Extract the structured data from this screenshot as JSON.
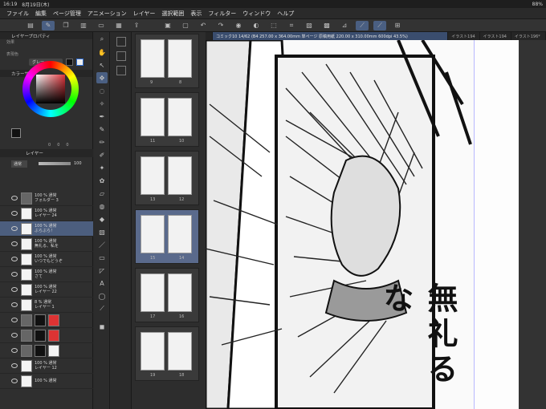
{
  "status": {
    "time": "16:19",
    "date": "8月19日(木)",
    "battery": "88%"
  },
  "menu": [
    "ファイル",
    "編集",
    "ページ管理",
    "アニメーション",
    "レイヤー",
    "選択範囲",
    "表示",
    "フィルター",
    "ウィンドウ",
    "ヘルプ"
  ],
  "tabs": [
    {
      "label": "コミック10"
    },
    {
      "label": "コミック10 14/62 (B4 257.00 x 364.00mm 単ページ 原稿用紙 220.00 x 310.00mm 600dpi 43.5%)"
    },
    {
      "label": "イラスト194"
    },
    {
      "label": "イラスト194"
    },
    {
      "label": "イラスト196*"
    }
  ],
  "left_panel": {
    "layer_property_title": "レイヤープロパティ",
    "effect_label": "効果",
    "preset_label": "表現色",
    "preset_value": "グレー",
    "color_circle_title": "カラーサークル",
    "color_values": [
      "0",
      "0",
      "0"
    ],
    "layer_title": "レイヤー",
    "blend_mode": "通常",
    "opacity": "100"
  },
  "layers": [
    {
      "line1": "100 % 通常",
      "line2": "フォルダー 3",
      "folder": true,
      "selected": false
    },
    {
      "line1": "100 % 通常",
      "line2": "レイヤー 24",
      "folder": false,
      "selected": false
    },
    {
      "line1": "100 % 通常",
      "line2": "ぶらぶら！",
      "folder": false,
      "selected": true
    },
    {
      "line1": "100 % 通常",
      "line2": "無礼る、私を",
      "folder": false,
      "selected": false
    },
    {
      "line1": "100 % 通常",
      "line2": "いつでもどうぞ",
      "folder": false,
      "selected": false
    },
    {
      "line1": "100 % 通常",
      "line2": "さて",
      "folder": false,
      "selected": false
    },
    {
      "line1": "100 % 通常",
      "line2": "レイヤー 22",
      "folder": false,
      "selected": false
    },
    {
      "line1": "8 % 通常",
      "line2": "レイヤー 1",
      "folder": false,
      "selected": false
    },
    {
      "line1": "",
      "line2": "",
      "folder": true,
      "selected": false
    },
    {
      "line1": "",
      "line2": "",
      "folder": true,
      "selected": false
    },
    {
      "line1": "",
      "line2": "",
      "folder": true,
      "selected": false
    },
    {
      "line1": "100 % 通常",
      "line2": "レイヤー 12",
      "folder": false,
      "selected": false
    },
    {
      "line1": "100 % 通常",
      "line2": "",
      "folder": false,
      "selected": false
    }
  ],
  "pages": [
    {
      "left": "9",
      "right": "8",
      "selected": false
    },
    {
      "left": "11",
      "right": "10",
      "selected": false
    },
    {
      "left": "13",
      "right": "12",
      "selected": false
    },
    {
      "left": "15",
      "right": "14",
      "selected": true
    },
    {
      "left": "17",
      "right": "16",
      "selected": false
    },
    {
      "left": "19",
      "right": "18",
      "selected": false
    }
  ],
  "canvas": {
    "sfx": "無礼るな"
  }
}
